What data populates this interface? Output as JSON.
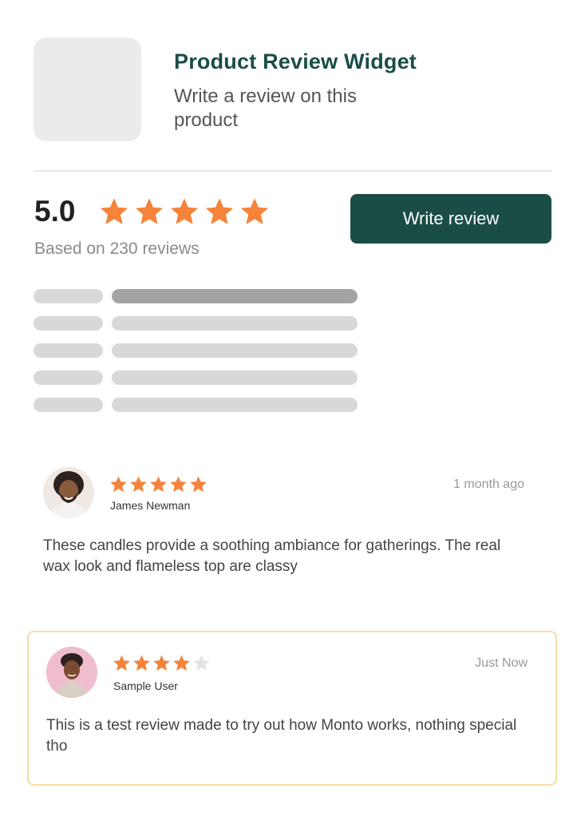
{
  "product": {
    "title": "Product Review Widget",
    "subtitle": "Write a review on this product"
  },
  "summary": {
    "average": "5.0",
    "average_stars": 5,
    "based_on": "Based on 230 reviews",
    "write_button": "Write review",
    "distribution_fill": [
      1.0,
      0,
      0,
      0,
      0
    ]
  },
  "reviews": [
    {
      "name": "James Newman",
      "rating": 5,
      "time": "1 month ago",
      "body": "These candles provide a soothing ambiance for gatherings. The real wax look and flameless top are classy"
    },
    {
      "name": "Sample User",
      "rating": 4,
      "time": "Just Now",
      "body": "This is a test review made to try out how Monto works, nothing special tho"
    }
  ],
  "colors": {
    "brand": "#1b4d47",
    "star": "#f5833a",
    "highlight_border": "#f7dca4"
  }
}
